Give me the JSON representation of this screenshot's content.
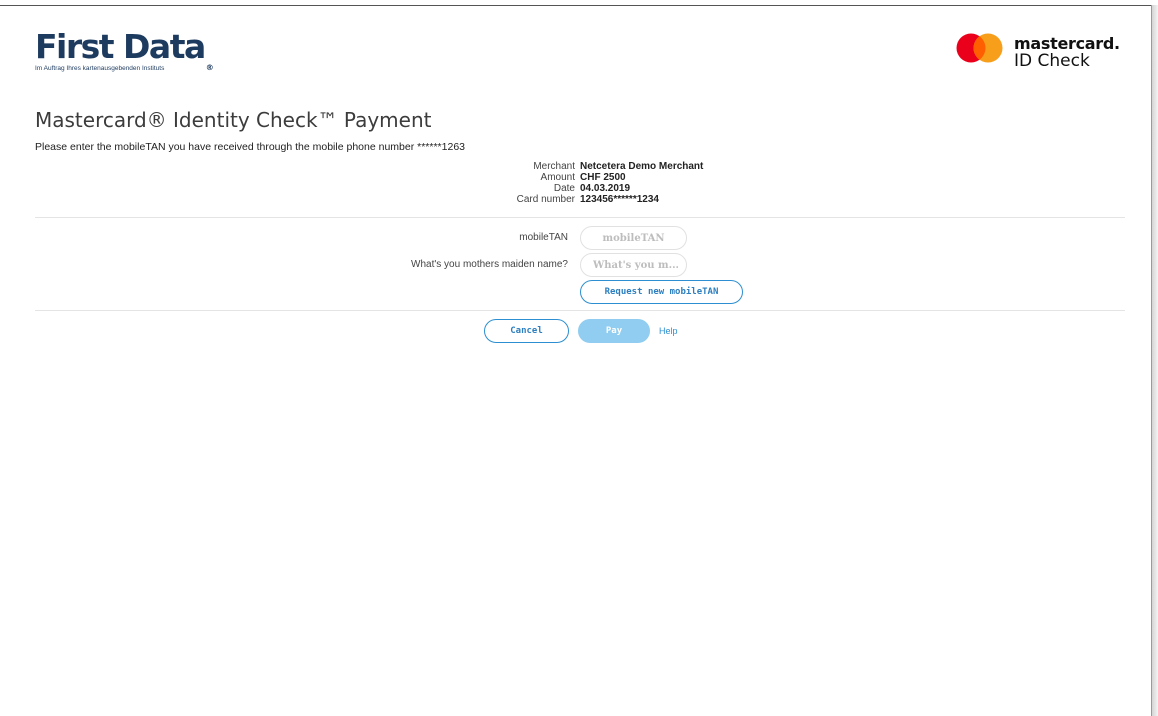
{
  "header": {
    "issuer_logo": {
      "name": "First Data",
      "registered_mark": "®",
      "tagline": "Im Auftrag Ihres kartenausgebenden Instituts"
    },
    "scheme_logo": {
      "brand": "mastercard",
      "brand_dot": ".",
      "product": "ID Check"
    }
  },
  "page": {
    "title": "Mastercard® Identity Check™ Payment",
    "instruction": "Please enter the mobileTAN you have received through the mobile phone number ******1263"
  },
  "transaction": [
    {
      "label": "Merchant",
      "value": "Netcetera Demo Merchant"
    },
    {
      "label": "Amount",
      "value": "CHF 2500"
    },
    {
      "label": "Date",
      "value": "04.03.2019"
    },
    {
      "label": "Card number",
      "value": "123456******1234"
    }
  ],
  "form": {
    "mobiletan": {
      "label": "mobileTAN",
      "placeholder": "mobileTAN",
      "value": ""
    },
    "maiden_name": {
      "label": "What's you mothers maiden name?",
      "placeholder": "What's you m...",
      "value": ""
    },
    "request_new_label": "Request new mobileTAN"
  },
  "actions": {
    "cancel_label": "Cancel",
    "pay_label": "Pay",
    "help_label": "Help"
  },
  "colors": {
    "brand_navy": "#1d3a5f",
    "accent_blue": "#2d8fd1",
    "pay_disabled": "#90cdf0",
    "mc_red": "#eb001b",
    "mc_orange": "#f79e1b",
    "mc_overlap": "#ff5f00"
  }
}
